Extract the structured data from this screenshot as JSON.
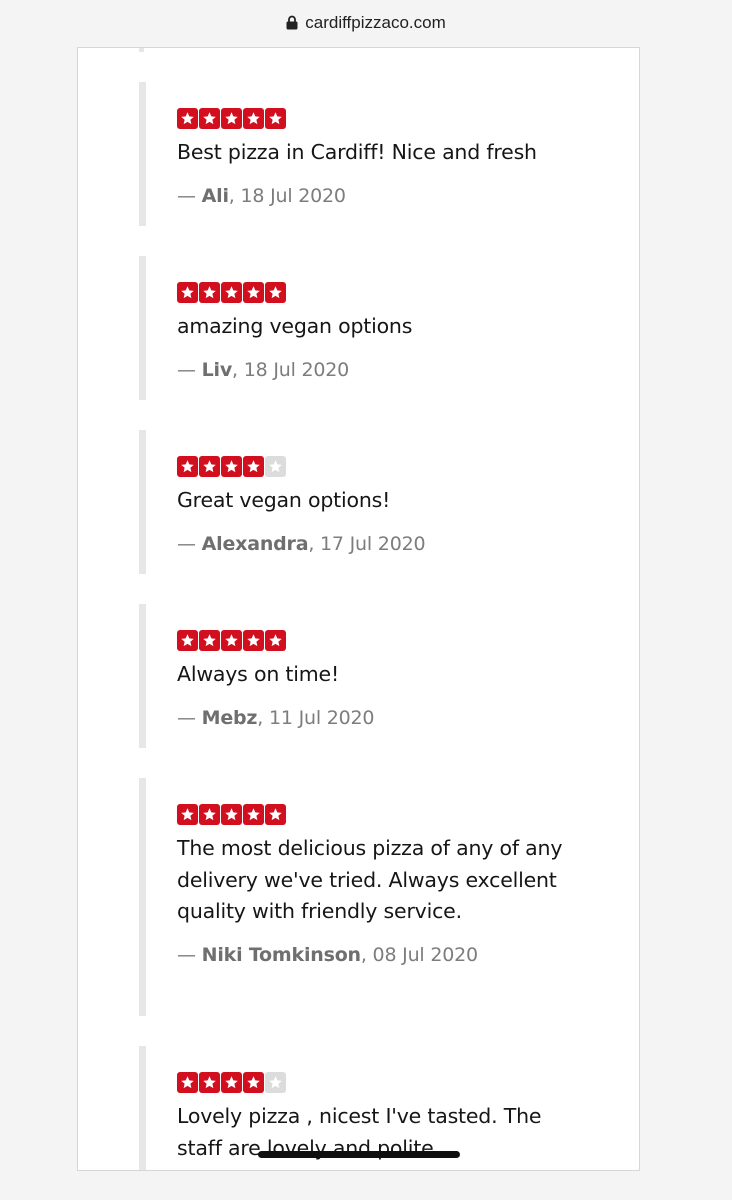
{
  "browser": {
    "url": "cardiffpizzaco.com"
  },
  "colors": {
    "star_filled": "#d10f1f",
    "star_empty": "#dcdcdc",
    "review_border": "#e7e7e7"
  },
  "reviews": [
    {
      "rating": 5,
      "text": "Best pizza in Cardiff! Nice and fresh",
      "dash": "— ",
      "author": "Ali",
      "date": ", 18 Jul 2020"
    },
    {
      "rating": 5,
      "text": "amazing vegan options",
      "dash": "— ",
      "author": "Liv",
      "date": ", 18 Jul 2020"
    },
    {
      "rating": 4,
      "text": "Great vegan options!",
      "dash": "— ",
      "author": "Alexandra",
      "date": ", 17 Jul 2020"
    },
    {
      "rating": 5,
      "text": "Always on time!",
      "dash": "— ",
      "author": "Mebz",
      "date": ", 11 Jul 2020"
    },
    {
      "rating": 5,
      "text": "The most delicious pizza of any of any delivery we've tried. Always excellent quality with friendly service.",
      "dash": "— ",
      "author": "Niki Tomkinson",
      "date": ", 08 Jul 2020"
    },
    {
      "rating": 4,
      "text": "Lovely pizza , nicest I've tasted. The staff are lovely and polite",
      "dash": "",
      "author": "",
      "date": ""
    }
  ]
}
